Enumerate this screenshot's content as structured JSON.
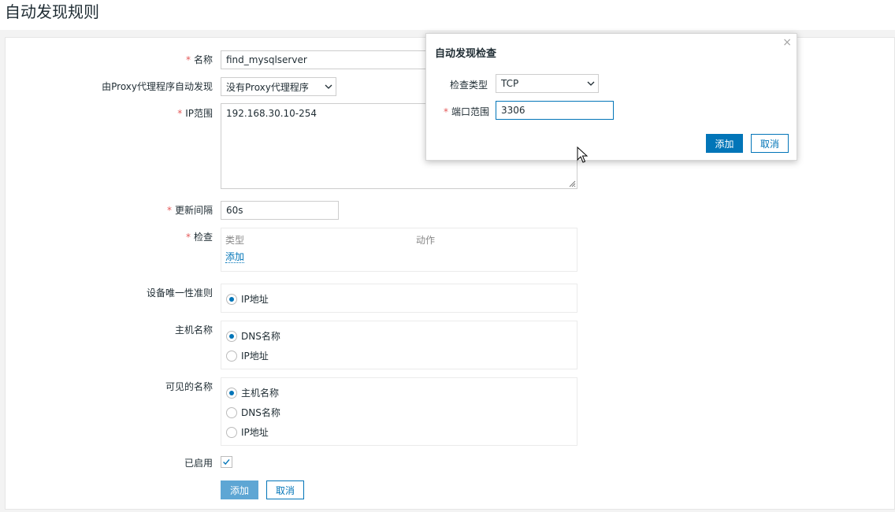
{
  "page": {
    "title": "自动发现规则"
  },
  "form": {
    "name": {
      "label": "名称",
      "value": "find_mysqlserver"
    },
    "proxy": {
      "label": "由Proxy代理程序自动发现",
      "value": "没有Proxy代理程序"
    },
    "ip_range": {
      "label": "IP范围",
      "value": "192.168.30.10-254"
    },
    "update_interval": {
      "label": "更新间隔",
      "value": "60s"
    },
    "checks": {
      "label": "检查",
      "col_type": "类型",
      "col_action": "动作",
      "add_link": "添加"
    },
    "uniqueness": {
      "label": "设备唯一性准则",
      "options": [
        {
          "label": "IP地址",
          "selected": true
        }
      ]
    },
    "host_name": {
      "label": "主机名称",
      "options": [
        {
          "label": "DNS名称",
          "selected": true
        },
        {
          "label": "IP地址",
          "selected": false
        }
      ]
    },
    "visible_name": {
      "label": "可见的名称",
      "options": [
        {
          "label": "主机名称",
          "selected": true
        },
        {
          "label": "DNS名称",
          "selected": false
        },
        {
          "label": "IP地址",
          "selected": false
        }
      ]
    },
    "enabled": {
      "label": "已启用",
      "checked": true
    },
    "buttons": {
      "add": "添加",
      "cancel": "取消"
    }
  },
  "modal": {
    "title": "自动发现检查",
    "check_type": {
      "label": "检查类型",
      "value": "TCP"
    },
    "port_range": {
      "label": "端口范围",
      "value": "3306"
    },
    "buttons": {
      "add": "添加",
      "cancel": "取消"
    },
    "close_icon": "×"
  },
  "colors": {
    "accent": "#0275b8",
    "required": "#e45959"
  }
}
